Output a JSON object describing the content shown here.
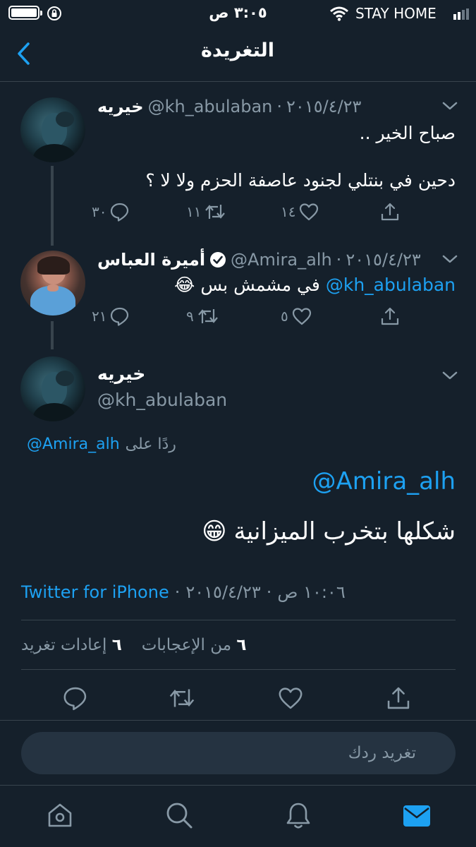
{
  "status_bar": {
    "time": "٣:٠٥ ص",
    "carrier": "STAY HOME"
  },
  "header": {
    "title": "التغريدة"
  },
  "tweets": [
    {
      "name": "خيريه",
      "handle": "@kh_abulaban",
      "date": "٢٠١٥/٤/٢٣",
      "line1": "صباح الخير ..",
      "line2": "دحين في بنتلي لجنود عاصفة الحزم ولا لا ؟",
      "replies": "٣٠",
      "retweets": "١١",
      "likes": "١٤"
    },
    {
      "name": "أميرة العباس",
      "handle": "@Amira_alh",
      "date": "٢٠١٥/٤/٢٣",
      "mention": "@kh_abulaban",
      "text": "في مشمش بس",
      "emoji": "😂",
      "replies": "٢١",
      "retweets": "٩",
      "likes": "٥"
    }
  ],
  "main_tweet": {
    "name": "خيريه",
    "handle": "@kh_abulaban",
    "replying_prefix": "ردًا على",
    "replying_handle": "@Amira_alh",
    "mention": "@Amira_alh",
    "text": "شكلها بتخرب الميزانية",
    "emoji": "😁",
    "source": "Twitter for iPhone",
    "date": "٢٠١٥/٤/٢٣",
    "time": "١٠:٠٦ ص",
    "likes_count": "٦",
    "likes_label": "من الإعجابات",
    "retweets_count": "٦",
    "retweets_label": "إعادات تغريد"
  },
  "reply_box": {
    "placeholder": "تغريد ردك"
  },
  "colors": {
    "background": "#15202b",
    "accent": "#1da1f2",
    "muted": "#8899a6",
    "divider": "#38444d"
  },
  "icons": {
    "back": "chevron-left-icon",
    "reply": "reply-icon",
    "retweet": "retweet-icon",
    "like": "heart-icon",
    "share": "share-icon",
    "verified": "verified-icon",
    "tab_home": "home-icon",
    "tab_search": "search-icon",
    "tab_notifications": "bell-icon",
    "tab_messages": "mail-icon"
  }
}
